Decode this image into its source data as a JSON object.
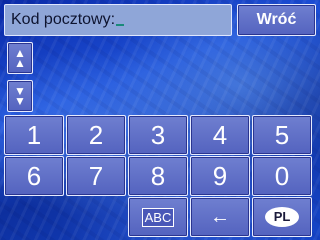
{
  "input": {
    "label": "Kod pocztowy:",
    "value": ""
  },
  "back_label": "Wróć",
  "scroll": {
    "up_icon": "up-arrows-icon",
    "down_icon": "down-arrows-icon"
  },
  "keys_row1": [
    "1",
    "2",
    "3",
    "4",
    "5"
  ],
  "keys_row2": [
    "6",
    "7",
    "8",
    "9",
    "0"
  ],
  "bottom": {
    "abc_label": "ABC",
    "backspace_icon": "←",
    "country_label": "PL"
  }
}
